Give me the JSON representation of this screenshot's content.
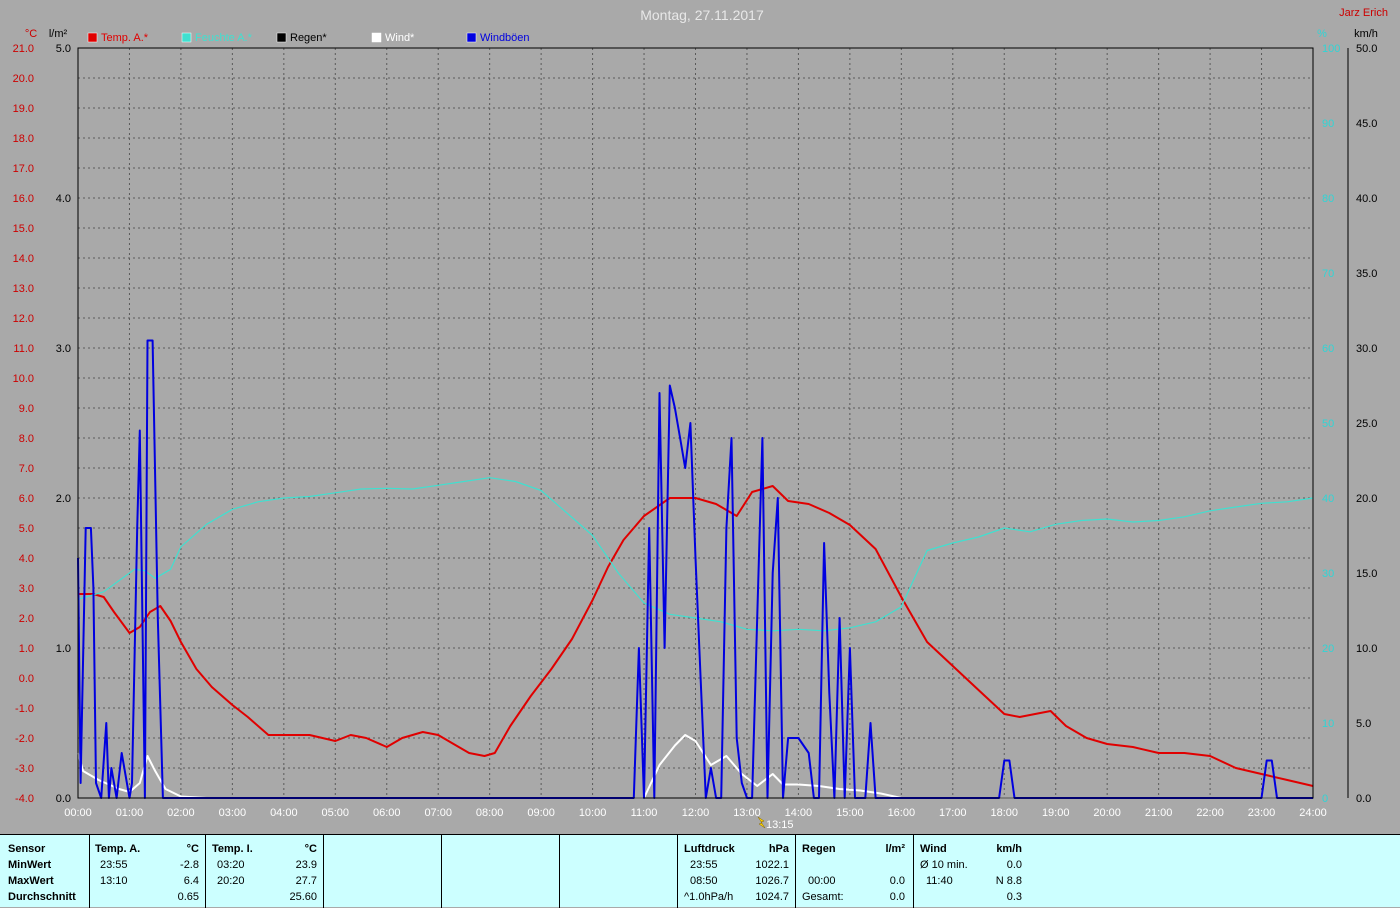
{
  "header": {
    "title": "Montag, 27.11.2017",
    "author": "Jarz Erich",
    "unit_temp": "°C",
    "unit_rain": "l/m²",
    "unit_hum": "%",
    "unit_wind": "km/h"
  },
  "colors": {
    "background": "#a9a9a9",
    "temp": "#e00000",
    "humidity": "#40e0d0",
    "rain": "#000000",
    "wind": "#ffffff",
    "gusts": "#0000e0",
    "table": "#ccffff"
  },
  "chart_data": {
    "type": "line",
    "title": "Montag, 27.11.2017",
    "x_ticks": [
      "00:00",
      "01:00",
      "02:00",
      "03:00",
      "04:00",
      "05:00",
      "06:00",
      "07:00",
      "08:00",
      "09:00",
      "10:00",
      "11:00",
      "12:00",
      "13:00",
      "14:00",
      "15:00",
      "16:00",
      "17:00",
      "18:00",
      "19:00",
      "20:00",
      "21:00",
      "22:00",
      "23:00",
      "24:00"
    ],
    "x_range_hours": [
      0,
      24
    ],
    "axes": {
      "temp": {
        "label": "°C",
        "range": [
          -4,
          21
        ],
        "ticks": [
          "21.0",
          "20.0",
          "19.0",
          "18.0",
          "17.0",
          "16.0",
          "15.0",
          "14.0",
          "13.0",
          "12.0",
          "11.0",
          "10.0",
          "9.0",
          "8.0",
          "7.0",
          "6.0",
          "5.0",
          "4.0",
          "3.0",
          "2.0",
          "1.0",
          "0.0",
          "-1.0",
          "-2.0",
          "-3.0",
          "-4.0"
        ]
      },
      "rain": {
        "label": "l/m²",
        "range": [
          0,
          5
        ],
        "ticks": [
          "5.0",
          "4.0",
          "3.0",
          "2.0",
          "1.0",
          "0.0"
        ]
      },
      "hum": {
        "label": "%",
        "range": [
          0,
          100
        ],
        "ticks": [
          "100",
          "90",
          "80",
          "70",
          "60",
          "50",
          "40",
          "30",
          "20",
          "10",
          "0"
        ]
      },
      "wind": {
        "label": "km/h",
        "range": [
          0,
          50
        ],
        "ticks": [
          "50.0",
          "45.0",
          "40.0",
          "35.0",
          "30.0",
          "25.0",
          "20.0",
          "15.0",
          "10.0",
          "5.0",
          "0.0"
        ]
      }
    },
    "marker": {
      "label": "13:15",
      "hour": 13.25
    },
    "grid": true,
    "legend": "top-left",
    "series": [
      {
        "name": "Temp. A.*",
        "axis": "temp",
        "color": "#e00000",
        "x": [
          0,
          0.3,
          0.5,
          0.7,
          1.0,
          1.2,
          1.4,
          1.6,
          1.8,
          2.0,
          2.3,
          2.6,
          3.0,
          3.3,
          3.7,
          4.0,
          4.5,
          5.0,
          5.3,
          5.6,
          6.0,
          6.3,
          6.7,
          7.0,
          7.3,
          7.6,
          7.9,
          8.1,
          8.4,
          8.8,
          9.2,
          9.6,
          10.0,
          10.3,
          10.6,
          11.0,
          11.5,
          12.0,
          12.4,
          12.8,
          13.1,
          13.5,
          13.8,
          14.2,
          14.6,
          15.0,
          15.5,
          16.0,
          16.5,
          17.0,
          17.5,
          18.0,
          18.3,
          18.6,
          18.9,
          19.2,
          19.6,
          20.0,
          20.5,
          21.0,
          21.5,
          22.0,
          22.5,
          23.0,
          23.5,
          24.0
        ],
        "y": [
          2.8,
          2.8,
          2.7,
          2.2,
          1.5,
          1.7,
          2.2,
          2.4,
          1.9,
          1.2,
          0.3,
          -0.3,
          -0.9,
          -1.3,
          -1.9,
          -1.9,
          -1.9,
          -2.1,
          -1.9,
          -2.0,
          -2.3,
          -2.0,
          -1.8,
          -1.9,
          -2.2,
          -2.5,
          -2.6,
          -2.5,
          -1.6,
          -0.6,
          0.3,
          1.3,
          2.6,
          3.7,
          4.6,
          5.4,
          6.0,
          6.0,
          5.8,
          5.4,
          6.2,
          6.4,
          5.9,
          5.8,
          5.5,
          5.1,
          4.3,
          2.7,
          1.2,
          0.4,
          -0.4,
          -1.2,
          -1.3,
          -1.2,
          -1.1,
          -1.6,
          -2.0,
          -2.2,
          -2.3,
          -2.5,
          -2.5,
          -2.6,
          -3.0,
          -3.2,
          -3.4,
          -3.6
        ]
      },
      {
        "name": "Feuchte A.*",
        "axis": "hum",
        "color": "#40e0d0",
        "x": [
          0,
          0.5,
          0.8,
          1.1,
          1.3,
          1.5,
          1.8,
          2.0,
          2.5,
          3.0,
          3.5,
          4.0,
          4.5,
          5.0,
          5.5,
          6.0,
          6.5,
          7.0,
          7.5,
          8.0,
          8.5,
          9.0,
          9.5,
          10.0,
          10.5,
          11.0,
          11.5,
          12.0,
          12.5,
          13.0,
          13.5,
          14.0,
          14.5,
          15.0,
          15.5,
          16.0,
          16.5,
          17.0,
          17.5,
          18.0,
          18.5,
          19.0,
          19.5,
          20.0,
          20.5,
          21.0,
          21.5,
          22.0,
          22.5,
          23.0,
          23.5,
          24.0
        ],
        "y": [
          26.5,
          27.5,
          29,
          30.5,
          30.3,
          29.3,
          30.5,
          33.5,
          36.5,
          38.5,
          39.5,
          40,
          40.2,
          40.7,
          41.2,
          41.3,
          41.2,
          41.7,
          42.2,
          42.7,
          42.2,
          41,
          38,
          35,
          30,
          26,
          24.5,
          24,
          23.5,
          22.5,
          22.3,
          22.5,
          22.3,
          22.7,
          23.5,
          25.5,
          33,
          34,
          34.8,
          36,
          35.5,
          36.5,
          37,
          37.2,
          36.8,
          37,
          37.5,
          38.3,
          38.8,
          39.3,
          39.5,
          40
        ]
      },
      {
        "name": "Regen*",
        "axis": "rain",
        "color": "#000000",
        "x": [],
        "y": []
      },
      {
        "name": "Wind*",
        "axis": "wind",
        "color": "#ffffff",
        "x": [
          0,
          0.1,
          0.4,
          0.8,
          1.0,
          1.2,
          1.35,
          1.5,
          1.7,
          2.0,
          2.5,
          11.0,
          11.3,
          11.6,
          11.8,
          12.0,
          12.3,
          12.6,
          12.9,
          13.2,
          13.5,
          13.7,
          14.0,
          14.4,
          14.8,
          15.2,
          15.6,
          16.0,
          17.0,
          24.0
        ],
        "y": [
          3.0,
          1.8,
          1.2,
          0.6,
          0.4,
          1.0,
          2.8,
          1.8,
          0.6,
          0.1,
          0,
          0,
          2.2,
          3.5,
          4.2,
          3.8,
          2.2,
          2.8,
          1.6,
          0.8,
          1.6,
          0.9,
          0.9,
          0.8,
          0.6,
          0.5,
          0.3,
          0,
          0,
          0
        ]
      },
      {
        "name": "Windböen",
        "axis": "wind",
        "color": "#0000e0",
        "x": [
          0,
          0.05,
          0.15,
          0.25,
          0.3,
          0.35,
          0.45,
          0.55,
          0.6,
          0.65,
          0.75,
          0.85,
          1.0,
          1.05,
          1.15,
          1.2,
          1.3,
          1.35,
          1.45,
          1.55,
          1.65,
          1.75,
          10.8,
          10.9,
          11.0,
          11.1,
          11.2,
          11.3,
          11.4,
          11.5,
          11.6,
          11.7,
          11.8,
          11.9,
          12.0,
          12.1,
          12.2,
          12.3,
          12.4,
          12.5,
          12.6,
          12.7,
          12.8,
          12.9,
          13.0,
          13.1,
          13.2,
          13.3,
          13.4,
          13.5,
          13.6,
          13.7,
          13.8,
          13.9,
          14.0,
          14.2,
          14.3,
          14.4,
          14.5,
          14.6,
          14.7,
          14.8,
          14.9,
          15.0,
          15.1,
          15.2,
          15.3,
          15.4,
          15.5,
          15.6,
          15.7,
          17.9,
          18.0,
          18.1,
          18.2,
          23.0,
          23.1,
          23.2,
          23.3,
          24.0
        ],
        "y": [
          16,
          1,
          18,
          18,
          14,
          1,
          0,
          5,
          0,
          2,
          0,
          3,
          0,
          1,
          18,
          24.5,
          0,
          30.5,
          30.5,
          12,
          0,
          0,
          0,
          10,
          0,
          18,
          0,
          27,
          10,
          27.5,
          26,
          24,
          22,
          25,
          16,
          8,
          0,
          2,
          0,
          0,
          18,
          24,
          4,
          1,
          0,
          0,
          12,
          24,
          0,
          15,
          20,
          0,
          4,
          4,
          4,
          3,
          0,
          0,
          17,
          7,
          0,
          12,
          0,
          10,
          0,
          0,
          0,
          5,
          0,
          0,
          0,
          0,
          2.5,
          2.5,
          0,
          0,
          2.5,
          2.5,
          0,
          0
        ]
      }
    ]
  },
  "table": {
    "sensor": {
      "head": "Sensor",
      "min": "MinWert",
      "max": "MaxWert",
      "avg": "Durchschnitt"
    },
    "temp_a": {
      "head": "Temp. A.",
      "unit": "°C",
      "min_time": "23:55",
      "min_val": "-2.8",
      "max_time": "13:10",
      "max_val": "6.4",
      "avg_val": "0.65"
    },
    "temp_i": {
      "head": "Temp. I.",
      "unit": "°C",
      "min_time": "03:20",
      "min_val": "23.9",
      "max_time": "20:20",
      "max_val": "27.7",
      "avg_val": "25.60"
    },
    "pressure": {
      "head": "Luftdruck",
      "unit": "hPa",
      "min_time": "23:55",
      "min_val": "1022.1",
      "max_time": "08:50",
      "max_val": "1026.7",
      "avg_label": "^1.0hPa/h",
      "avg_val": "1024.7"
    },
    "rain": {
      "head": "Regen",
      "unit": "l/m²",
      "max_time": "00:00",
      "max_val": "0.0",
      "avg_label": "Gesamt:",
      "avg_val": "0.0"
    },
    "wind": {
      "head": "Wind",
      "unit": "km/h",
      "min_label": "Ø 10 min.",
      "min_val": "0.0",
      "max_time": "11:40",
      "max_val": "N 8.8",
      "avg_val": "0.3"
    }
  }
}
